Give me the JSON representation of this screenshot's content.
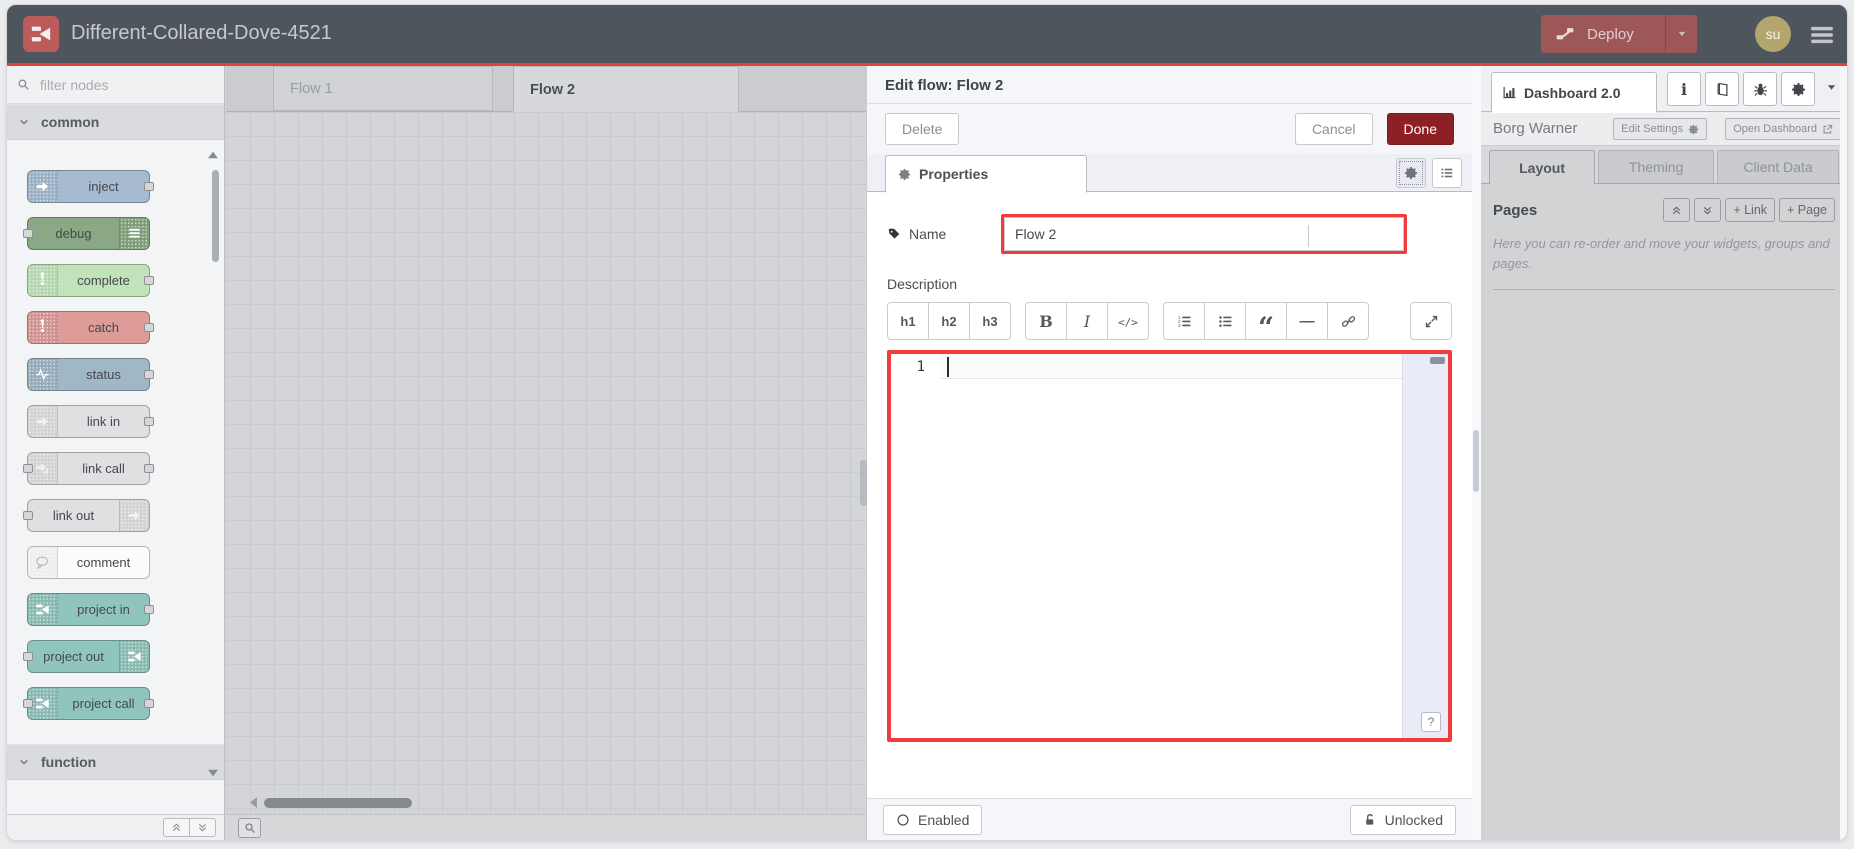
{
  "colors": {
    "header_bg": "#4f555c",
    "accent_red": "#e1423c",
    "deploy_bg": "#9d5757",
    "done_bg": "#8c2025",
    "annotation_red": "#f23b3b"
  },
  "header": {
    "title": "Different-Collared-Dove-4521",
    "deploy_label": "Deploy",
    "avatar": "su"
  },
  "palette": {
    "filter_placeholder": "filter nodes",
    "categories": [
      {
        "label": "common"
      },
      {
        "label": "function"
      }
    ],
    "nodes": [
      {
        "label": "inject",
        "color": "#a6bbcf",
        "icon": "inject-arrow",
        "icon_color": "#ffffff",
        "icon_side": "left",
        "port_left": false,
        "port_right": true
      },
      {
        "label": "debug",
        "color": "#89a883",
        "icon": "debug-list",
        "icon_color": "#ffffff",
        "icon_side": "right",
        "port_left": true,
        "port_right": false
      },
      {
        "label": "complete",
        "color": "#c1e3ba",
        "icon": "exclamation",
        "icon_color": "#ffffff",
        "icon_side": "left",
        "port_left": false,
        "port_right": true
      },
      {
        "label": "catch",
        "color": "#dd9c98",
        "icon": "exclamation",
        "icon_color": "#ffffff",
        "icon_side": "left",
        "port_left": false,
        "port_right": true
      },
      {
        "label": "status",
        "color": "#9fb7c6",
        "icon": "waveform",
        "icon_color": "#ffffff",
        "icon_side": "left",
        "port_left": false,
        "port_right": true
      },
      {
        "label": "link in",
        "color": "#e0e0e2",
        "icon": "link-arrow",
        "icon_color": "#f2f2f2",
        "icon_side": "left",
        "port_left": false,
        "port_right": true
      },
      {
        "label": "link call",
        "color": "#e0e0e2",
        "icon": "link-call",
        "icon_color": "#f2f2f2",
        "icon_side": "left",
        "port_left": true,
        "port_right": true
      },
      {
        "label": "link out",
        "color": "#e0e0e2",
        "icon": "link-arrow",
        "icon_color": "#f2f2f2",
        "icon_side": "right",
        "port_left": true,
        "port_right": false
      },
      {
        "label": "comment",
        "color": "#fcfcfd",
        "icon": "speech-bubble",
        "icon_color": "#b9bcbf",
        "icon_side": "left",
        "port_left": false,
        "port_right": false
      },
      {
        "label": "project in",
        "color": "#90c5bd",
        "icon": "node-red",
        "icon_color": "#ffffff",
        "icon_side": "left",
        "port_left": false,
        "port_right": true
      },
      {
        "label": "project out",
        "color": "#90c5bd",
        "icon": "node-red",
        "icon_color": "#ffffff",
        "icon_side": "right",
        "port_left": true,
        "port_right": false
      },
      {
        "label": "project call",
        "color": "#90c5bd",
        "icon": "node-red",
        "icon_color": "#ffffff",
        "icon_side": "left",
        "port_left": true,
        "port_right": true
      }
    ]
  },
  "workspace": {
    "tabs": [
      {
        "label": "Flow 1"
      },
      {
        "label": "Flow 2"
      }
    ]
  },
  "edit_panel": {
    "title": "Edit flow: Flow 2",
    "delete_label": "Delete",
    "cancel_label": "Cancel",
    "done_label": "Done",
    "properties_tab_label": "Properties",
    "name_label": "Name",
    "name_value": "Flow 2",
    "description_label": "Description",
    "description_toolbar": {
      "groups": [
        {
          "buttons": [
            {
              "name": "heading-1",
              "label": "h1"
            },
            {
              "name": "heading-2",
              "label": "h2"
            },
            {
              "name": "heading-3",
              "label": "h3"
            }
          ]
        },
        {
          "buttons": [
            {
              "name": "bold",
              "icon": "bold"
            },
            {
              "name": "italic",
              "icon": "italic"
            },
            {
              "name": "code",
              "icon": "code"
            }
          ]
        },
        {
          "buttons": [
            {
              "name": "ordered-list",
              "icon": "ordered-list"
            },
            {
              "name": "unordered-list",
              "icon": "unordered-list"
            },
            {
              "name": "blockquote",
              "icon": "quote"
            },
            {
              "name": "horizontal-rule",
              "icon": "hr"
            },
            {
              "name": "hyperlink",
              "icon": "link-chain"
            }
          ]
        }
      ],
      "expand": {
        "name": "expand-editor",
        "icon": "expand"
      }
    },
    "editor": {
      "line_number": "1",
      "help_label": "?"
    },
    "footer": {
      "enabled_label": "Enabled",
      "unlocked_label": "Unlocked"
    }
  },
  "sidebar": {
    "tab_label": "Dashboard 2.0",
    "toolbar_icons": [
      "info",
      "book",
      "bug",
      "gear"
    ],
    "project_name": "Borg Warner",
    "edit_settings_label": "Edit Settings",
    "open_dashboard_label": "Open Dashboard",
    "tabs": [
      "Layout",
      "Theming",
      "Client Data"
    ],
    "pages": {
      "title": "Pages",
      "link_label": "+ Link",
      "page_label": "+ Page",
      "help_text": "Here you can re-order and move your widgets, groups and pages."
    }
  }
}
